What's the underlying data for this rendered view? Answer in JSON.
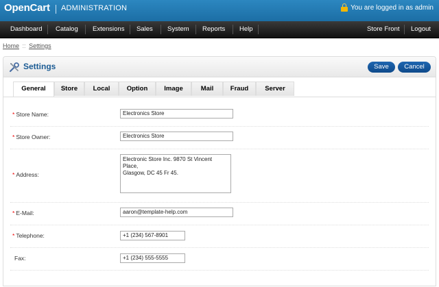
{
  "header": {
    "logo": "OpenCart",
    "admin_title": "ADMINISTRATION",
    "login_text": "You are logged in as admin"
  },
  "menu": {
    "left": [
      "Dashboard",
      "Catalog",
      "Extensions",
      "Sales",
      "System",
      "Reports",
      "Help"
    ],
    "right": [
      "Store Front",
      "Logout"
    ]
  },
  "breadcrumb": {
    "home": "Home",
    "separator": "::",
    "current": "Settings"
  },
  "box": {
    "title": "Settings",
    "save_label": "Save",
    "cancel_label": "Cancel"
  },
  "tabs": [
    "General",
    "Store",
    "Local",
    "Option",
    "Image",
    "Mail",
    "Fraud",
    "Server"
  ],
  "active_tab": "General",
  "form": {
    "store_name": {
      "label": "Store Name:",
      "value": "Electronics Store",
      "required": true
    },
    "store_owner": {
      "label": "Store Owner:",
      "value": "Electronics Store",
      "required": true
    },
    "address": {
      "label": "Address:",
      "value": "Electronic Store Inc. 9870 St Vincent Place,\nGlasgow, DC 45 Fr 45.",
      "required": true
    },
    "email": {
      "label": "E-Mail:",
      "value": "aaron@template-help.com",
      "required": true
    },
    "telephone": {
      "label": "Telephone:",
      "value": "+1 (234) 567-8901",
      "required": true
    },
    "fax": {
      "label": "Fax:",
      "value": "+1 (234) 555-5555",
      "required": false
    }
  },
  "colors": {
    "header_blue": "#1c6ea5",
    "menu_dark": "#111111",
    "button_blue": "#0f4a8a",
    "title_blue": "#1b5b94",
    "required_red": "#ee0000"
  },
  "icons": {
    "settings": "wrench-screwdriver-icon",
    "lock": "padlock-icon"
  }
}
